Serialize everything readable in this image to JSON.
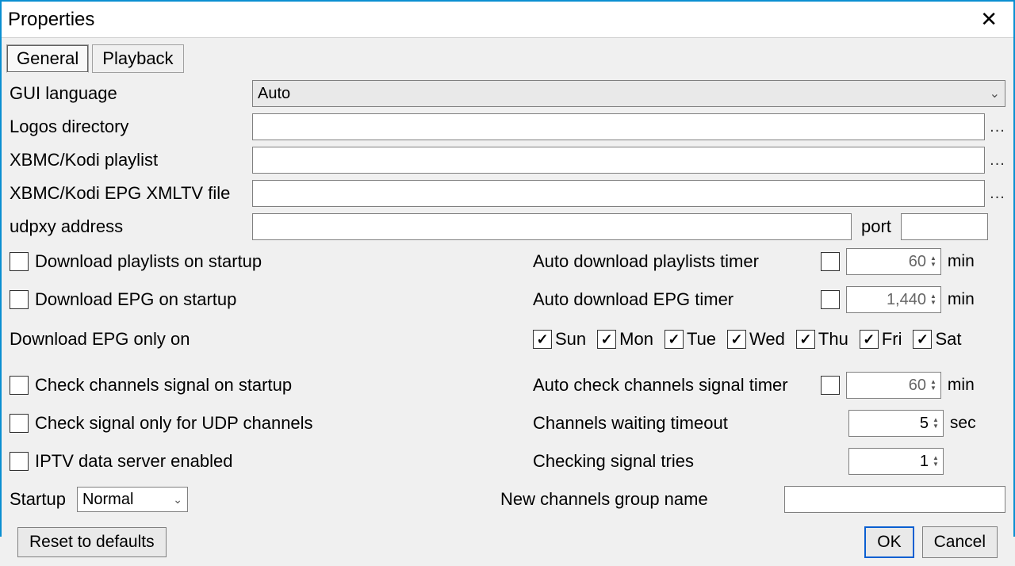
{
  "window": {
    "title": "Properties"
  },
  "tabs": {
    "general": "General",
    "playback": "Playback",
    "active": "General"
  },
  "labels": {
    "gui_language": "GUI language",
    "logos_dir": "Logos directory",
    "kodi_playlist": "XBMC/Kodi playlist",
    "kodi_epg": "XBMC/Kodi EPG XMLTV file",
    "udpxy_addr": "udpxy address",
    "port": "port",
    "dl_playlists_startup": "Download playlists on startup",
    "dl_epg_startup": "Download EPG on startup",
    "auto_dl_playlists_timer": "Auto download playlists timer",
    "auto_dl_epg_timer": "Auto download EPG timer",
    "dl_epg_only_on": "Download EPG only on",
    "check_channels_startup": "Check channels signal on startup",
    "check_udp_only": "Check signal only for UDP channels",
    "iptv_server_enabled": "IPTV data server enabled",
    "auto_check_signal_timer": "Auto check channels signal timer",
    "channels_wait_timeout": "Channels waiting timeout",
    "checking_signal_tries": "Checking signal tries",
    "startup": "Startup",
    "new_channels_group": "New channels group name"
  },
  "values": {
    "gui_language": "Auto",
    "logos_dir": "",
    "kodi_playlist": "",
    "kodi_epg": "",
    "udpxy_addr": "",
    "udpxy_port": "",
    "dl_playlists_startup": false,
    "dl_epg_startup": false,
    "auto_dl_playlists_enabled": false,
    "auto_dl_playlists_timer": "60",
    "auto_dl_epg_enabled": false,
    "auto_dl_epg_timer": "1,440",
    "check_channels_startup": false,
    "check_udp_only": false,
    "iptv_server_enabled": false,
    "auto_check_signal_enabled": false,
    "auto_check_signal_timer": "60",
    "channels_wait_timeout": "5",
    "checking_signal_tries": "1",
    "startup_mode": "Normal",
    "new_channels_group": ""
  },
  "units": {
    "min": "min",
    "sec": "sec"
  },
  "days": {
    "sun": {
      "label": "Sun",
      "checked": true
    },
    "mon": {
      "label": "Mon",
      "checked": true
    },
    "tue": {
      "label": "Tue",
      "checked": true
    },
    "wed": {
      "label": "Wed",
      "checked": true
    },
    "thu": {
      "label": "Thu",
      "checked": true
    },
    "fri": {
      "label": "Fri",
      "checked": true
    },
    "sat": {
      "label": "Sat",
      "checked": true
    }
  },
  "buttons": {
    "reset": "Reset to defaults",
    "ok": "OK",
    "cancel": "Cancel",
    "browse": "..."
  }
}
